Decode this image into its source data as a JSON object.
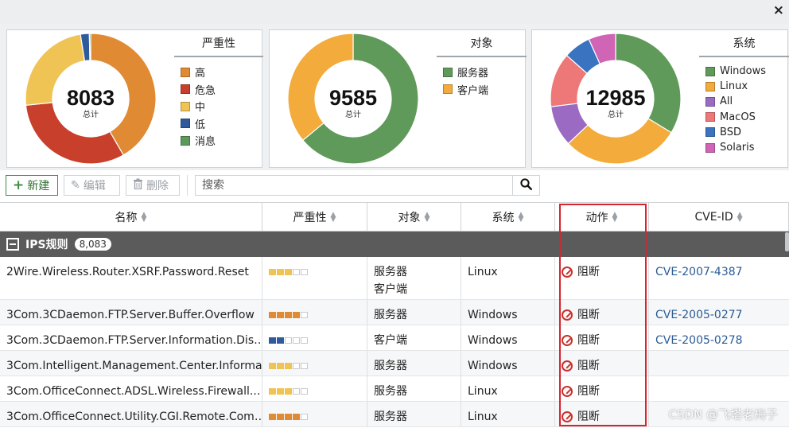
{
  "window": {
    "close_icon": "×"
  },
  "severity_chart": {
    "total": "8083",
    "total_label": "总计",
    "legend_title": "严重性",
    "center_color": "#fff",
    "slices": [
      {
        "label": "高",
        "color": "#e08b34",
        "fraction": 0.38
      },
      {
        "label": "危急",
        "color": "#c8402b",
        "fraction": 0.29
      },
      {
        "label": "中",
        "color": "#f0c454",
        "fraction": 0.22
      },
      {
        "label": "低",
        "color": "#2f5b9d",
        "fraction": 0.02
      },
      {
        "label": "消息",
        "color": "#5c9a5c",
        "fraction": 0.003
      }
    ]
  },
  "target_chart": {
    "total": "9585",
    "total_label": "总计",
    "legend_title": "对象",
    "slices": [
      {
        "label": "服务器",
        "color": "#5f9a5a",
        "fraction": 0.64
      },
      {
        "label": "客户端",
        "color": "#f3ab3c",
        "fraction": 0.36
      }
    ]
  },
  "os_chart": {
    "total": "12985",
    "total_label": "总计",
    "legend_title": "系统",
    "slices": [
      {
        "label": "Windows",
        "color": "#5f9a5a",
        "fraction": 0.3
      },
      {
        "label": "Linux",
        "color": "#f3ab3c",
        "fraction": 0.26
      },
      {
        "label": "All",
        "color": "#9b6ac2",
        "fraction": 0.09
      },
      {
        "label": "MacOS",
        "color": "#ee7777",
        "fraction": 0.12
      },
      {
        "label": "BSD",
        "color": "#3a73c0",
        "fraction": 0.06
      },
      {
        "label": "Solaris",
        "color": "#d064b5",
        "fraction": 0.06
      }
    ]
  },
  "toolbar": {
    "new_label": "新建",
    "edit_label": "编辑",
    "delete_label": "删除",
    "search_placeholder": "搜索"
  },
  "table": {
    "headers": [
      "名称",
      "严重性",
      "对象",
      "系统",
      "动作",
      "CVE-ID"
    ],
    "group": {
      "label": "IPS规则",
      "count": "8,083"
    },
    "severity_colors": {
      "high": "#e08b34",
      "critical": "#c8402b",
      "medium": "#f0c454",
      "low": "#2f5b9d"
    },
    "rows": [
      {
        "name": "2Wire.Wireless.Router.XSRF.Password.Reset",
        "severity": "medium",
        "level": 3,
        "targets": [
          "服务器",
          "客户端"
        ],
        "os": "Linux",
        "action": "阻断",
        "cve": "CVE-2007-4387"
      },
      {
        "name": "3Com.3CDaemon.FTP.Server.Buffer.Overflow",
        "severity": "high",
        "level": 4,
        "targets": [
          "服务器"
        ],
        "os": "Windows",
        "action": "阻断",
        "cve": "CVE-2005-0277"
      },
      {
        "name": "3Com.3CDaemon.FTP.Server.Information.Dis…",
        "severity": "low",
        "level": 2,
        "targets": [
          "客户端"
        ],
        "os": "Windows",
        "action": "阻断",
        "cve": "CVE-2005-0278"
      },
      {
        "name": "3Com.Intelligent.Management.Center.Informa…",
        "severity": "medium",
        "level": 3,
        "targets": [
          "服务器"
        ],
        "os": "Windows",
        "action": "阻断",
        "cve": ""
      },
      {
        "name": "3Com.OfficeConnect.ADSL.Wireless.Firewall.…",
        "severity": "medium",
        "level": 3,
        "targets": [
          "服务器"
        ],
        "os": "Linux",
        "action": "阻断",
        "cve": ""
      },
      {
        "name": "3Com.OfficeConnect.Utility.CGI.Remote.Com…",
        "severity": "high",
        "level": 4,
        "targets": [
          "服务器"
        ],
        "os": "Linux",
        "action": "阻断",
        "cve": ""
      }
    ]
  },
  "watermark": "CSDN @飞塔老梅子"
}
